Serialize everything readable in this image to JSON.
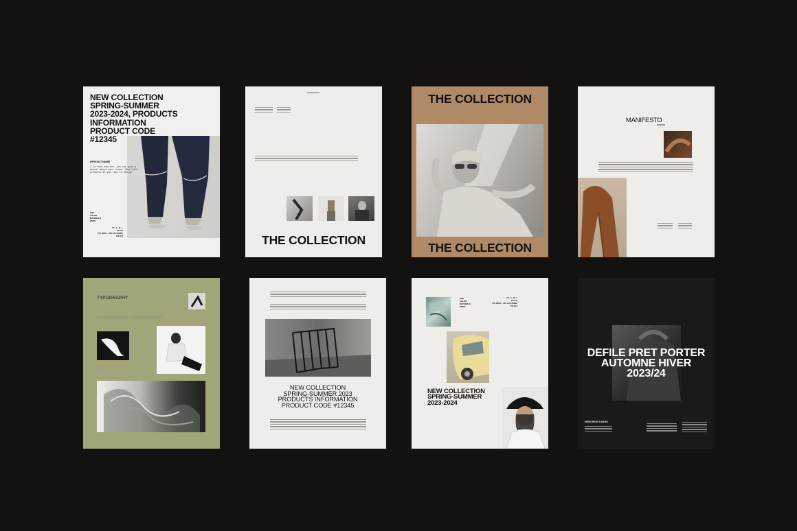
{
  "colors": {
    "background": "#141210",
    "paper": "#efedea",
    "tan": "#b08a66",
    "olive": "#a2a579",
    "dark_page": "#1b1a19"
  },
  "page1": {
    "heading_lines": [
      "NEW COLLECTION",
      "SPRING-SUMMER",
      "2023-2024, PRODUCTS",
      "INFORMATION",
      "PRODUCT CODE",
      "#12345"
    ],
    "product_name": "(PRODUCT NAME)",
    "body_lines": [
      "I In this section, you can give a",
      "detail about your brand. What kind",
      "products do you like to design"
    ],
    "spec_labels": [
      "SIZE",
      "COLOR",
      "MATERIALS",
      "PRICE"
    ],
    "spec_values": [
      "XS - S - M - L",
      "BLACK",
      "70% WOOL - 30% POLYAMIDE",
      "250.00 $"
    ]
  },
  "page2": {
    "title": "THE COLLECTION"
  },
  "page3": {
    "title_top": "THE COLLECTION",
    "title_bottom": "THE COLLECTION"
  },
  "page4": {
    "title": "MANIFESTO"
  },
  "page5": {
    "title": "TYPOGRAPHY"
  },
  "page6": {
    "heading_lines": [
      "NEW COLLECTION",
      "SPRING-SUMMER 2023",
      "PRODUCTS  INFORMATION",
      "PRODUCT CODE #12345"
    ]
  },
  "page7": {
    "spec_labels": [
      "SIZE",
      "COLOR",
      "MATERIALS",
      "PRICE"
    ],
    "spec_values": [
      "XS - S - M - L",
      "BLACK",
      "70% WOOL - 30% POLYAMIDE",
      "250.00 $"
    ],
    "heading_lines": [
      "NEW COLLECTION",
      "SPRING-SUMMER",
      "2023-2024"
    ]
  },
  "page8": {
    "heading_lines": [
      "DEFILE PRET  PORTER",
      "AUTOMNE HIVER",
      "2023/24"
    ],
    "date": "MERCREDI 4 MARS"
  }
}
